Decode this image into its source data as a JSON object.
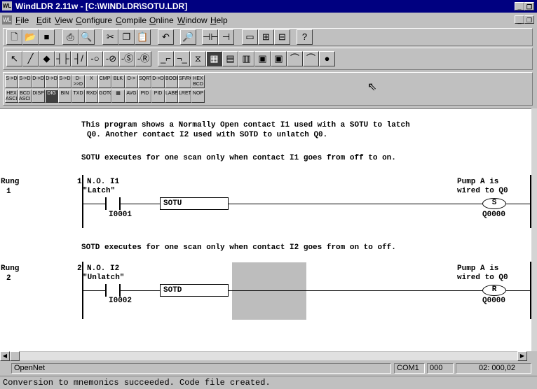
{
  "window": {
    "title": "WindLDR 2.11w - [C:\\WINDLDR\\SOTU.LDR]",
    "app_icon": "WL",
    "doc_icon": "WL"
  },
  "menu": [
    "File",
    "Edit",
    "View",
    "Configure",
    "Compile",
    "Online",
    "Window",
    "Help"
  ],
  "toolbar1": [
    "new-icon",
    "open-icon",
    "save-icon",
    "print-icon",
    "print-preview-icon",
    "cut-icon",
    "copy-icon",
    "paste-icon",
    "undo-icon",
    "find-icon",
    "monitor-icon",
    "rung-icon",
    "device-icon",
    "ladder-icon",
    "ladder2-icon",
    "help-icon"
  ],
  "toolbar2": [
    "select-icon",
    "line-icon",
    "eraser-icon",
    "contact-no-icon",
    "contact-nc-icon",
    "coil-icon",
    "coil-not-icon",
    "set-coil-icon",
    "reset-coil-icon",
    "sotu-icon",
    "sotd-icon",
    "timer-icon",
    "counter-icon",
    "shift-icon",
    "sfr-icon",
    "mcs-icon",
    "mcr-icon",
    "jump-icon",
    "jump-end-icon",
    "end-icon"
  ],
  "toolbar3_row1": [
    "S->D",
    "S->D",
    "D->D",
    "D->D",
    "S->D",
    "D->>D",
    "X",
    "CMP",
    "BLK",
    "D->",
    "SQRT",
    "D->D",
    "BOOL",
    "SF/RO",
    "HEX BCD"
  ],
  "toolbar3_row2": [
    "HEX ASCII",
    "BCD ASCII",
    "DISP",
    "DIG",
    "BIN",
    "TXD",
    "RXD",
    "GOTO",
    "AVG",
    "PID",
    "PID",
    "LABEL",
    "LRET",
    "NOP"
  ],
  "ladder": {
    "comment1": "This program shows a Normally Open contact I1 used with a SOTU to latch",
    "comment2": "Q0. Another contact I2 used with SOTD to unlatch Q0.",
    "note1": "SOTU executes for one scan only when contact I1 goes from off to on.",
    "note2": "SOTD executes for one scan only when contact I2 goes from on to off.",
    "rungs": [
      {
        "label": "Rung",
        "num": "1",
        "idx": "1",
        "contact_label": "N.O. I1",
        "contact_comment": "\"Latch\"",
        "contact_addr": "I0001",
        "func": "SOTU",
        "coil_comment1": "Pump A is",
        "coil_comment2": "wired to Q0",
        "coil_type": "S",
        "coil_addr": "Q0000"
      },
      {
        "label": "Rung",
        "num": "2",
        "idx": "2",
        "contact_label": "N.O. I2",
        "contact_comment": "\"Unlatch\"",
        "contact_addr": "I0002",
        "func": "SOTD",
        "coil_comment1": "Pump A is",
        "coil_comment2": "wired to Q0",
        "coil_type": "R",
        "coil_addr": "Q0000"
      }
    ]
  },
  "status": {
    "left": "OpenNet",
    "port": "COM1",
    "station": "000",
    "position": "02: 000,02"
  },
  "message": "Conversion to mnemonics succeeded. Code file created."
}
